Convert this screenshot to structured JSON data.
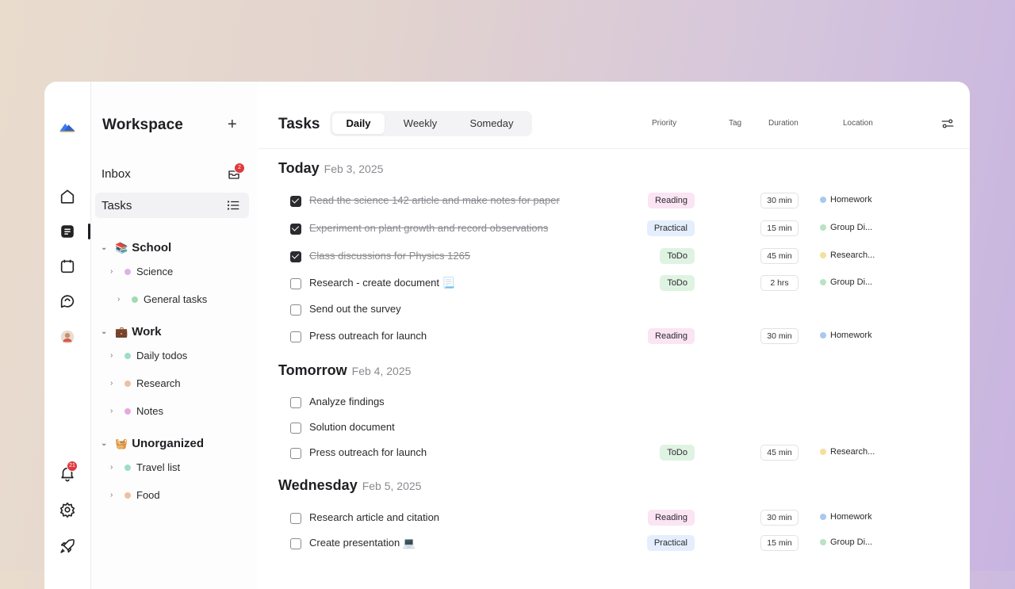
{
  "sidebar": {
    "title": "Workspace",
    "add_glyph": "+",
    "inbox_label": "Inbox",
    "inbox_count": "2",
    "tasks_label": "Tasks",
    "groups": [
      {
        "name": "School",
        "emoji": "📚",
        "items": [
          {
            "label": "Science",
            "color": "#dcb3e8"
          },
          {
            "label": "General tasks",
            "color": "#9fdcb0"
          }
        ]
      },
      {
        "name": "Work",
        "emoji": "💼",
        "items": [
          {
            "label": "Daily todos",
            "color": "#9fdcc9"
          },
          {
            "label": "Research",
            "color": "#f0bfa3"
          },
          {
            "label": "Notes",
            "color": "#e7a7e2"
          }
        ]
      },
      {
        "name": "Unorganized",
        "emoji": "🧺",
        "items": [
          {
            "label": "Travel list",
            "color": "#9fdcc9"
          },
          {
            "label": "Food",
            "color": "#f0bfa3"
          }
        ]
      }
    ]
  },
  "rail": {
    "notifications_count": "21"
  },
  "header": {
    "title": "Tasks",
    "tabs": [
      "Daily",
      "Weekly",
      "Someday"
    ],
    "selected_tab": "Daily",
    "columns": {
      "priority": "Priority",
      "tag": "Tag",
      "duration": "Duration",
      "location": "Location"
    }
  },
  "days": [
    {
      "name": "Today",
      "date": "Feb 3, 2025",
      "tasks": [
        {
          "text": "Read the science 142 article and make notes for paper",
          "done": true,
          "flag": true,
          "tag": "Reading",
          "tag_color": "pink",
          "duration": "30 min",
          "location": "Homework",
          "loc_color": "#a9c8f0"
        },
        {
          "text": "Experiment on plant growth and record observations",
          "done": true,
          "flag": false,
          "tag": "Practical",
          "tag_color": "blue",
          "duration": "15 min",
          "location": "Group Di...",
          "loc_color": "#b9e3c2"
        },
        {
          "text": "Class discussions for Physics 1265",
          "done": true,
          "flag": false,
          "tag": "ToDo",
          "tag_color": "green",
          "duration": "45 min",
          "location": "Research...",
          "loc_color": "#f6df9a"
        },
        {
          "text": "Research - create document 📃",
          "done": false,
          "flag": false,
          "tag": "ToDo",
          "tag_color": "green",
          "duration": "2 hrs",
          "location": "Group Di...",
          "loc_color": "#b9e3c2"
        },
        {
          "text": "Send out the survey",
          "done": false,
          "flag": false,
          "tag": "",
          "tag_color": "",
          "duration": "",
          "location": "",
          "loc_color": ""
        },
        {
          "text": "Press outreach for launch",
          "done": false,
          "flag": false,
          "tag": "Reading",
          "tag_color": "pink",
          "duration": "30 min",
          "location": "Homework",
          "loc_color": "#a9c8f0"
        }
      ]
    },
    {
      "name": "Tomorrow",
      "date": "Feb 4, 2025",
      "tasks": [
        {
          "text": "Analyze findings",
          "done": false,
          "flag": false,
          "tag": "",
          "tag_color": "",
          "duration": "",
          "location": "",
          "loc_color": ""
        },
        {
          "text": "Solution document",
          "done": false,
          "flag": false,
          "tag": "",
          "tag_color": "",
          "duration": "",
          "location": "",
          "loc_color": ""
        },
        {
          "text": "Press outreach for launch",
          "done": false,
          "flag": true,
          "tag": "ToDo",
          "tag_color": "green",
          "duration": "45 min",
          "location": "Research...",
          "loc_color": "#f6df9a"
        }
      ]
    },
    {
      "name": "Wednesday",
      "date": "Feb 5, 2025",
      "tasks": [
        {
          "text": "Research article and citation",
          "done": false,
          "flag": true,
          "tag": "Reading",
          "tag_color": "pink",
          "duration": "30 min",
          "location": "Homework",
          "loc_color": "#a9c8f0"
        },
        {
          "text": "Create presentation 💻",
          "done": false,
          "flag": true,
          "tag": "Practical",
          "tag_color": "blue",
          "duration": "15 min",
          "location": "Group Di...",
          "loc_color": "#b9e3c2"
        }
      ]
    }
  ],
  "colors": {
    "flag": "#e0373f",
    "accent_blue": "#3b7cf5",
    "accent_yellow": "#f5c542"
  }
}
